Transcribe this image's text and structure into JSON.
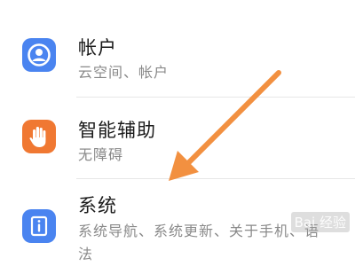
{
  "settings": {
    "items": [
      {
        "title": "帐户",
        "subtitle": "云空间、帐户",
        "icon": "account-person-icon",
        "icon_color": "#4a84f0"
      },
      {
        "title": "智能辅助",
        "subtitle": "无障碍",
        "icon": "hand-assist-icon",
        "icon_color": "#f07832"
      },
      {
        "title": "系统",
        "subtitle": "系统导航、系统更新、关于手机、语",
        "subtitle_cont": "法",
        "icon": "system-info-icon",
        "icon_color": "#4a84f0"
      }
    ]
  },
  "annotation": {
    "arrow_color": "#f29040"
  },
  "watermark": {
    "text": "Bai 经验"
  }
}
